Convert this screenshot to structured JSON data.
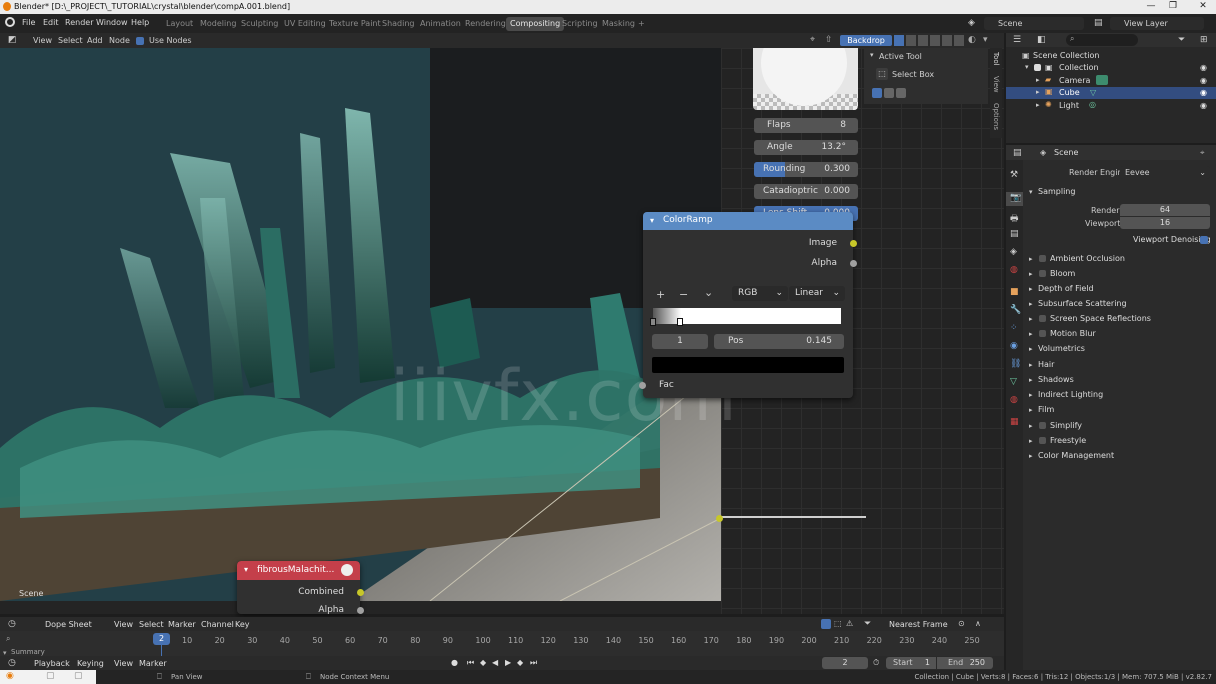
{
  "window": {
    "title": "Blender* [D:\\_PROJECT\\_TUTORIAL\\crystal\\blender\\compA.001.blend]"
  },
  "menu": [
    "File",
    "Edit",
    "Render",
    "Window",
    "Help"
  ],
  "workspaces": [
    "Layout",
    "Modeling",
    "Sculpting",
    "UV Editing",
    "Texture Paint",
    "Shading",
    "Animation",
    "Rendering",
    "Compositing",
    "Scripting",
    "Masking",
    "+"
  ],
  "active_workspace": "Compositing",
  "scene_field": "Scene",
  "view_layer_field": "View Layer",
  "node_header": {
    "items": [
      "View",
      "Select",
      "Add",
      "Node"
    ],
    "use_nodes": "Use Nodes",
    "backdrop": "Backdrop"
  },
  "viewport_label": "Scene",
  "watermark": "iiivfx.com",
  "lens": {
    "flaps_label": "Flaps",
    "flaps_value": "8",
    "angle_label": "Angle",
    "angle_value": "13.2°",
    "rounding_label": "Rounding",
    "rounding_value": "0.300",
    "catadioptric_label": "Catadioptric",
    "catadioptric_value": "0.000",
    "lensshift_label": "Lens Shift",
    "lensshift_value": "0.000",
    "rounding_fill": 0.3
  },
  "tool_panel": {
    "title": "Active Tool",
    "tool": "Select Box",
    "tabs": [
      "Tool",
      "View",
      "Options"
    ]
  },
  "colorramp": {
    "title": "ColorRamp",
    "out_image": "Image",
    "out_alpha": "Alpha",
    "plus": "+",
    "minus": "−",
    "chev": "⌄",
    "color_mode": "RGB",
    "interp": "Linear",
    "stop_index": "1",
    "pos_label": "Pos",
    "pos_value": "0.145",
    "in_fac": "Fac",
    "stop_positions": [
      0.0,
      0.145
    ]
  },
  "image_node": {
    "title": "fibrousMalachit...",
    "out_combined": "Combined",
    "out_alpha": "Alpha"
  },
  "outliner": {
    "root": "Scene Collection",
    "items": [
      {
        "label": "Collection"
      },
      {
        "label": "Camera"
      },
      {
        "label": "Cube"
      },
      {
        "label": "Light"
      }
    ]
  },
  "properties": {
    "context": "Scene",
    "render_engine_label": "Render Engine",
    "render_engine_value": "Eevee",
    "sampling": "Sampling",
    "render_label": "Render",
    "render_value": "64",
    "viewport_label": "Viewport",
    "viewport_value": "16",
    "viewport_denoising": "Viewport Denoising",
    "panels": [
      "Ambient Occlusion",
      "Bloom",
      "Depth of Field",
      "Subsurface Scattering",
      "Screen Space Reflections",
      "Motion Blur",
      "Volumetrics",
      "Hair",
      "Shadows",
      "Indirect Lighting",
      "Film",
      "Simplify",
      "Freestyle",
      "Color Management"
    ]
  },
  "timeline": {
    "editor": "Dope Sheet",
    "menus": [
      "View",
      "Select",
      "Marker",
      "Channel",
      "Key"
    ],
    "snap": "Nearest Frame",
    "current_frame": "2",
    "ticks": [
      "10",
      "20",
      "30",
      "40",
      "50",
      "60",
      "70",
      "80",
      "90",
      "100",
      "110",
      "120",
      "130",
      "140",
      "150",
      "160",
      "170",
      "180",
      "190",
      "200",
      "210",
      "220",
      "230",
      "240",
      "250"
    ],
    "summary": "Summary",
    "playback": "Playback",
    "keying": "Keying",
    "view": "View",
    "marker": "Marker",
    "frame_field": "2",
    "start_label": "Start",
    "start_value": "1",
    "end_label": "End",
    "end_value": "250"
  },
  "status": {
    "pan": "Pan View",
    "context_menu": "Node Context Menu",
    "stats": "Collection | Cube | Verts:8 | Faces:6 | Tris:12 | Objects:1/3 | Mem: 707.5 MiB | v2.82.7"
  }
}
